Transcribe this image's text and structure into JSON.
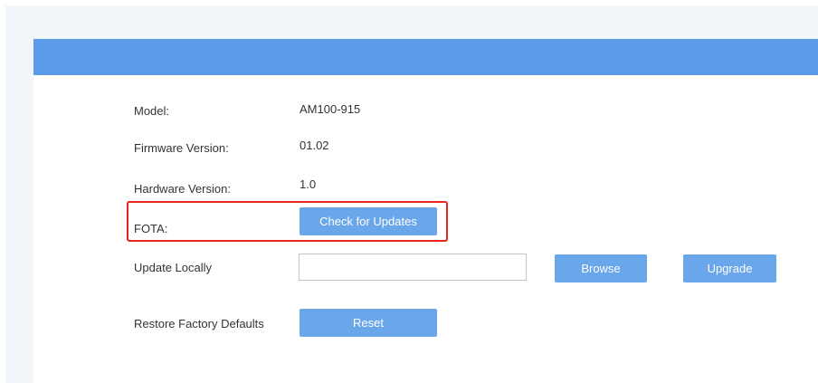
{
  "info": {
    "model_label": "Model:",
    "model_value": "AM100-915",
    "firmware_label": "Firmware Version:",
    "firmware_value": "01.02",
    "hardware_label": "Hardware Version:",
    "hardware_value": "1.0"
  },
  "fota": {
    "label": "FOTA:",
    "check_button": "Check for Updates"
  },
  "update_locally": {
    "label": "Update Locally",
    "file_value": "",
    "browse_button": "Browse",
    "upgrade_button": "Upgrade"
  },
  "restore": {
    "label": "Restore Factory Defaults",
    "reset_button": "Reset"
  },
  "colors": {
    "header": "#5b9be9",
    "button": "#6aa6ea",
    "highlight": "#e8241c",
    "page_background": "#f2f5f9"
  }
}
